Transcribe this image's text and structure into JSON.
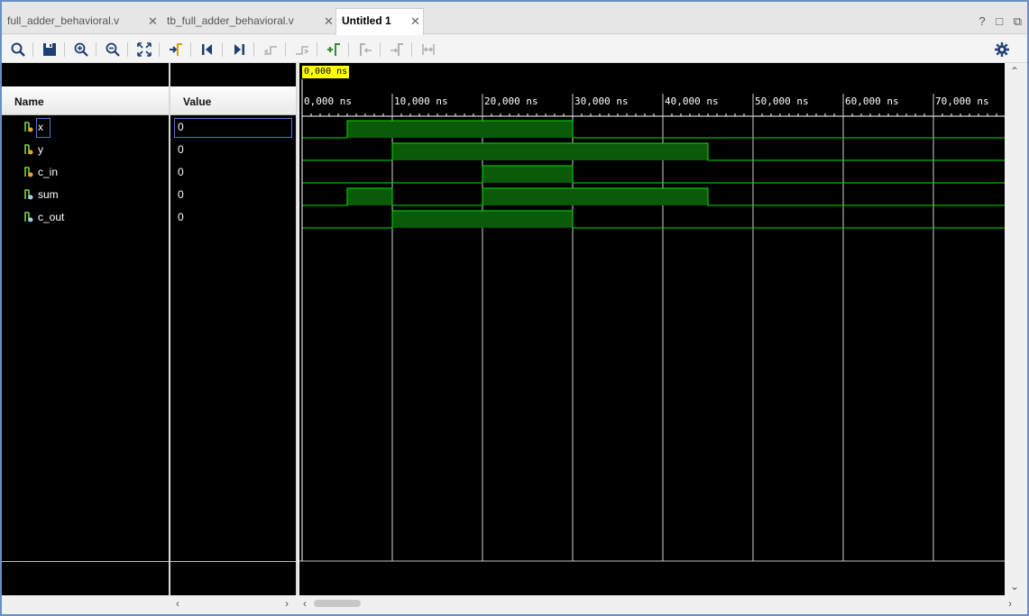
{
  "tabs": [
    {
      "label": "full_adder_behavioral.v",
      "active": false
    },
    {
      "label": "tb_full_adder_behavioral.v",
      "active": false
    },
    {
      "label": "Untitled 1",
      "active": true
    }
  ],
  "window_controls": {
    "help": "?",
    "restore": "□",
    "float": "⧉"
  },
  "toolbar": [
    {
      "icon": "search-icon"
    },
    {
      "icon": "save-icon"
    },
    {
      "icon": "zoom-in-icon"
    },
    {
      "icon": "zoom-out-icon"
    },
    {
      "icon": "zoom-fit-icon"
    },
    {
      "icon": "go-to-cursor-icon"
    },
    {
      "icon": "go-to-time-zero-icon"
    },
    {
      "icon": "go-to-last-time-icon"
    },
    {
      "icon": "previous-transition-icon"
    },
    {
      "icon": "next-transition-icon"
    },
    {
      "icon": "add-marker-icon"
    },
    {
      "icon": "previous-marker-icon"
    },
    {
      "icon": "next-marker-icon"
    },
    {
      "icon": "swap-cursors-icon"
    },
    {
      "icon": "settings-icon"
    }
  ],
  "columns": {
    "name": "Name",
    "value": "Value"
  },
  "signals": [
    {
      "name": "x",
      "value": "0",
      "kind": "input"
    },
    {
      "name": "y",
      "value": "0",
      "kind": "input"
    },
    {
      "name": "c_in",
      "value": "0",
      "kind": "input"
    },
    {
      "name": "sum",
      "value": "0",
      "kind": "output"
    },
    {
      "name": "c_out",
      "value": "0",
      "kind": "output"
    }
  ],
  "cursor": {
    "label": "0,000 ns",
    "time_ns": 0
  },
  "timeline": {
    "unit": "ns",
    "ticks": [
      {
        "t": 0,
        "label": "0,000 ns"
      },
      {
        "t": 10,
        "label": "10,000 ns"
      },
      {
        "t": 20,
        "label": "20,000 ns"
      },
      {
        "t": 30,
        "label": "30,000 ns"
      },
      {
        "t": 40,
        "label": "40,000 ns"
      },
      {
        "t": 50,
        "label": "50,000 ns"
      },
      {
        "t": 60,
        "label": "60,000 ns"
      },
      {
        "t": 70,
        "label": "70,000 ns"
      }
    ],
    "range_ns": [
      0,
      77.8
    ]
  },
  "waveforms": [
    {
      "signal": "x",
      "high": [
        [
          5,
          30
        ]
      ]
    },
    {
      "signal": "y",
      "high": [
        [
          10,
          45
        ]
      ]
    },
    {
      "signal": "c_in",
      "high": [
        [
          20,
          30
        ]
      ]
    },
    {
      "signal": "sum",
      "high": [
        [
          5,
          10
        ],
        [
          20,
          45
        ]
      ]
    },
    {
      "signal": "c_out",
      "high": [
        [
          10,
          30
        ]
      ]
    }
  ],
  "colors": {
    "wave": "#00e000",
    "wave_fill": "#0a5a0a",
    "grid": "#d0d0d0",
    "cursor_bg": "#ffff00"
  }
}
